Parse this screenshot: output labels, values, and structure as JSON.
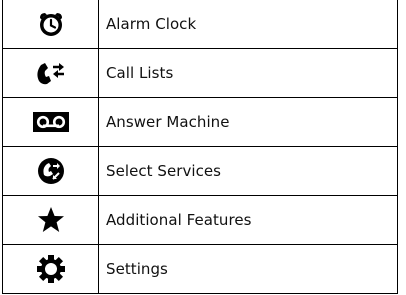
{
  "menu": {
    "items": [
      {
        "icon": "alarm-clock-icon",
        "label": "Alarm Clock"
      },
      {
        "icon": "call-lists-icon",
        "label": "Call Lists"
      },
      {
        "icon": "answer-machine-icon",
        "label": "Answer Machine"
      },
      {
        "icon": "select-services-icon",
        "label": "Select Services"
      },
      {
        "icon": "star-icon",
        "label": "Additional Features"
      },
      {
        "icon": "gear-icon",
        "label": "Settings"
      }
    ]
  },
  "colors": {
    "icon": "#000000",
    "text": "#111111",
    "border": "#000000",
    "background": "#ffffff"
  }
}
